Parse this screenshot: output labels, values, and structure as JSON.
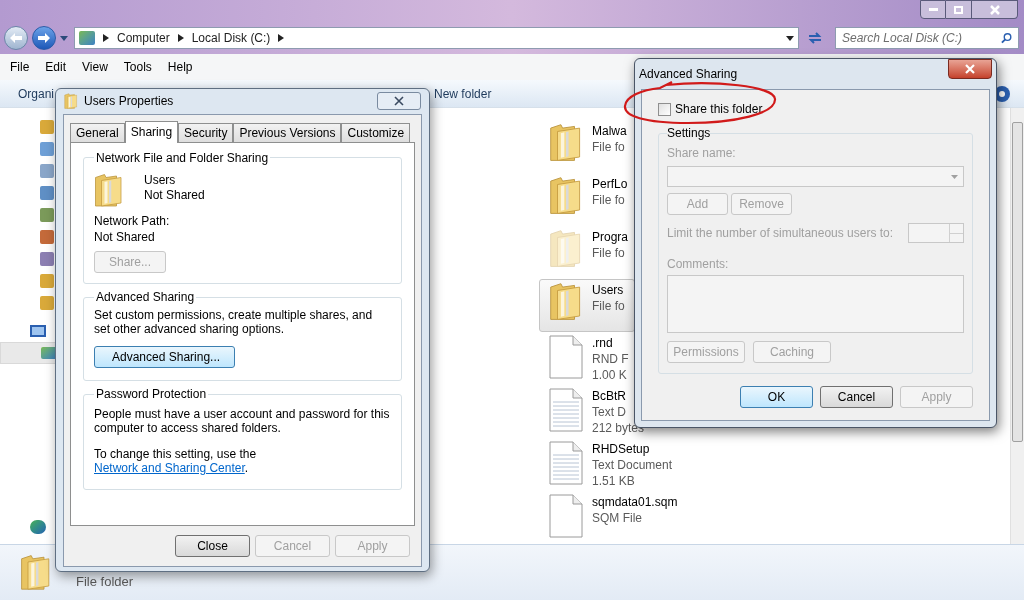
{
  "explorer": {
    "breadcrumb": [
      "Computer",
      "Local Disk (C:)"
    ],
    "search": {
      "placeholder": "Search Local Disk (C:)"
    },
    "menu": [
      "File",
      "Edit",
      "View",
      "Tools",
      "Help"
    ],
    "toolbar": [
      "Organi",
      "New folder"
    ],
    "files": [
      {
        "kind": "folder",
        "name": "Malwa",
        "lines": [
          "File fo"
        ],
        "selected": false,
        "hidden": false
      },
      {
        "kind": "folder",
        "name": "PerfLo",
        "lines": [
          "File fo"
        ],
        "selected": false,
        "hidden": false
      },
      {
        "kind": "folder",
        "name": "Progra",
        "lines": [
          "File fo"
        ],
        "selected": false,
        "hidden": true
      },
      {
        "kind": "folder",
        "name": "Users",
        "lines": [
          "File fo"
        ],
        "selected": true,
        "hidden": false
      },
      {
        "kind": "blank",
        "name": ".rnd",
        "lines": [
          "RND F",
          "1.00 K"
        ],
        "selected": false,
        "hidden": false
      },
      {
        "kind": "text",
        "name": "BcBtR",
        "lines": [
          "Text D",
          "212 bytes"
        ],
        "selected": false,
        "hidden": false
      },
      {
        "kind": "text",
        "name": "RHDSetup",
        "lines": [
          "Text Document",
          "1.51 KB"
        ],
        "selected": false,
        "hidden": false
      },
      {
        "kind": "blank",
        "name": "sqmdata01.sqm",
        "lines": [
          "SQM File"
        ],
        "selected": false,
        "hidden": false
      }
    ],
    "details": {
      "type": "File folder"
    }
  },
  "properties": {
    "title": "Users Properties",
    "tabs": [
      {
        "label": "General",
        "selected": false
      },
      {
        "label": "Sharing",
        "selected": true
      },
      {
        "label": "Security",
        "selected": false
      },
      {
        "label": "Previous Versions",
        "selected": false
      },
      {
        "label": "Customize",
        "selected": false
      }
    ],
    "network": {
      "legend": "Network File and Folder Sharing",
      "folder": "Users",
      "status": "Not Shared",
      "path_label": "Network Path:",
      "path": "Not Shared",
      "share_button": {
        "label": "Share...",
        "disabled": true
      }
    },
    "advanced": {
      "legend": "Advanced Sharing",
      "text": "Set custom permissions, create multiple shares, and set other advanced sharing options.",
      "button": {
        "label": "Advanced Sharing...",
        "disabled": false
      }
    },
    "password": {
      "legend": "Password Protection",
      "text": "People must have a user account and password for this computer to access shared folders.",
      "link_prefix": "To change this setting, use the ",
      "link": "Network and Sharing Center",
      "link_suffix": "."
    },
    "buttons": [
      {
        "label": "Close",
        "disabled": false
      },
      {
        "label": "Cancel",
        "disabled": true
      },
      {
        "label": "Apply",
        "disabled": true
      }
    ]
  },
  "advanced_sharing": {
    "title": "Advanced Sharing",
    "share": {
      "label": "Share this folder",
      "checked": false
    },
    "settings": {
      "legend": "Settings",
      "disabled": true,
      "share_name_label": "Share name:",
      "add": "Add",
      "remove": "Remove",
      "limit_label": "Limit the number of simultaneous users to:",
      "comments_label": "Comments:",
      "permissions": "Permissions",
      "caching": "Caching"
    },
    "buttons": [
      {
        "label": "OK",
        "disabled": false,
        "default": true
      },
      {
        "label": "Cancel",
        "disabled": false,
        "default": false
      },
      {
        "label": "Apply",
        "disabled": true,
        "default": false
      }
    ]
  }
}
